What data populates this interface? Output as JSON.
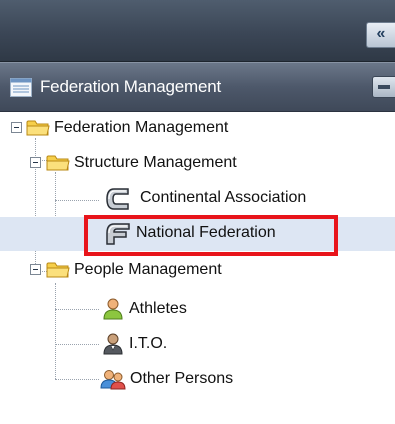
{
  "toolbar": {
    "collapse_label": "«"
  },
  "panel": {
    "title": "Federation Management",
    "icon": "list-icon",
    "collapse_icon": "minus-icon"
  },
  "tree": {
    "root": {
      "label": "Federation Management",
      "icon": "folder-icon",
      "expanded": true
    },
    "structure": {
      "label": "Structure Management",
      "icon": "folder-icon",
      "expanded": true
    },
    "continental": {
      "label": "Continental Association",
      "icon": "continental-logo-icon"
    },
    "national": {
      "label": "National Federation",
      "icon": "national-logo-icon",
      "selected": true
    },
    "people": {
      "label": "People Management",
      "icon": "folder-icon",
      "expanded": true
    },
    "athletes": {
      "label": "Athletes",
      "icon": "athlete-person-icon"
    },
    "ito": {
      "label": "I.T.O.",
      "icon": "official-person-icon"
    },
    "others": {
      "label": "Other Persons",
      "icon": "group-persons-icon"
    }
  },
  "colors": {
    "header_bg": "#4d586a",
    "selection_bg": "#dde6f3",
    "highlight": "#e8141b",
    "folder": "#f2c23a"
  }
}
